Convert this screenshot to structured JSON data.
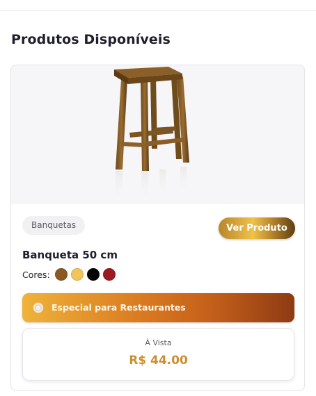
{
  "section": {
    "title": "Produtos Disponíveis"
  },
  "product": {
    "image_subject": "wooden-stool",
    "category": "Banquetas",
    "view_button_label": "Ver Produto",
    "name": "Banqueta 50 cm",
    "colors_label": "Cores:",
    "colors": [
      {
        "name": "brown",
        "hex": "#8a5a22"
      },
      {
        "name": "yellow",
        "hex": "#f2c45a"
      },
      {
        "name": "black",
        "hex": "#050505"
      },
      {
        "name": "red",
        "hex": "#9c1b22"
      }
    ],
    "special_icon": "plate-icon",
    "special_label": "Especial para Restaurantes",
    "price_label": "À Vista",
    "price": "R$ 44.00"
  }
}
